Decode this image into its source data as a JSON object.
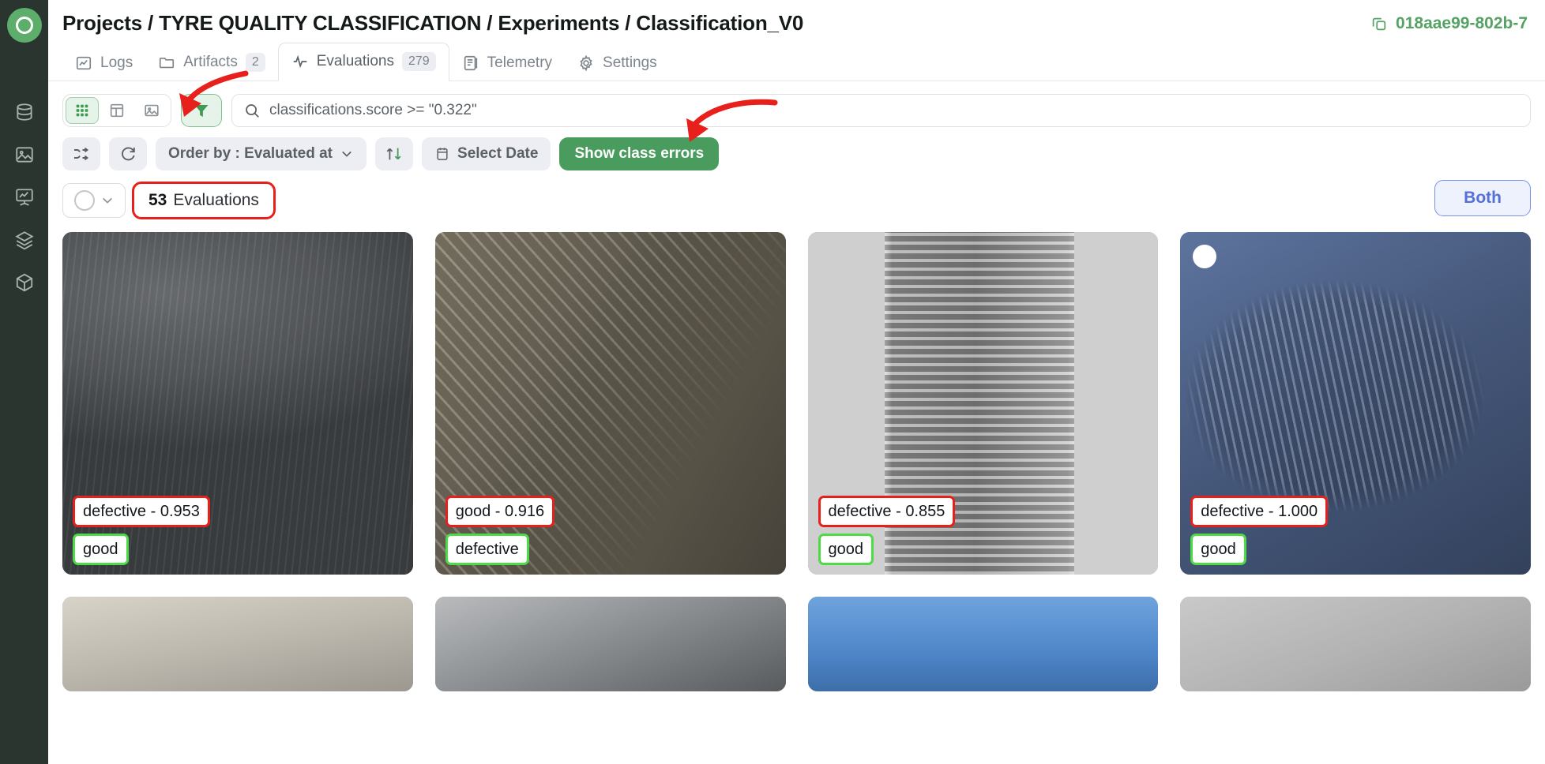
{
  "sidebar": {
    "logo_name": "app-logo",
    "items": [
      {
        "icon": "database-icon",
        "name": "datasets"
      },
      {
        "icon": "image-icon",
        "name": "images"
      },
      {
        "icon": "chart-board-icon",
        "name": "experiments"
      },
      {
        "icon": "layers-icon",
        "name": "layers"
      },
      {
        "icon": "cube-icon",
        "name": "models"
      }
    ]
  },
  "header": {
    "breadcrumb": "Projects / TYRE QUALITY CLASSIFICATION / Experiments / Classification_V0",
    "run_id": "018aae99-802b-7",
    "copy_icon": "copy-icon",
    "run_id_color": "#56a264"
  },
  "tabs": [
    {
      "label": "Logs",
      "icon": "line-chart-icon",
      "badge": "",
      "active": false
    },
    {
      "label": "Artifacts",
      "icon": "folder-icon",
      "badge": "2",
      "active": false
    },
    {
      "label": "Evaluations",
      "icon": "activity-icon",
      "badge": "279",
      "active": true
    },
    {
      "label": "Telemetry",
      "icon": "telemetry-icon",
      "badge": "",
      "active": false
    },
    {
      "label": "Settings",
      "icon": "gear-icon",
      "badge": "",
      "active": false
    }
  ],
  "toolbar": {
    "view_modes": [
      {
        "name": "grid-view",
        "icon": "grid-icon",
        "active": true
      },
      {
        "name": "table-view",
        "icon": "table-icon",
        "active": false
      },
      {
        "name": "image-view",
        "icon": "image-icon",
        "active": false
      }
    ],
    "filter_button": {
      "name": "filter-button",
      "icon": "funnel-icon",
      "active": true
    },
    "search": {
      "icon": "search-icon",
      "value": "classifications.score >= \"0.322\"",
      "placeholder": "Search"
    },
    "shuffle_button": {
      "icon": "shuffle-icon",
      "label": ""
    },
    "refresh_button": {
      "icon": "refresh-icon",
      "label": ""
    },
    "order_by": {
      "label": "Order by : Evaluated at",
      "chevron": "chevron-down-icon"
    },
    "sort_direction": {
      "label": "↑↓"
    },
    "select_date": {
      "label": "Select Date",
      "icon": "calendar-icon"
    },
    "show_class_errors": {
      "label": "Show class errors",
      "color": "#4a9b5e"
    }
  },
  "results": {
    "count": "53",
    "count_label": "Evaluations",
    "highlight_color": "#e8201c",
    "both_toggle": {
      "label": "Both",
      "color": "#5570d6"
    },
    "selector": {
      "icon": "circle-icon",
      "chevron": "chevron-down-icon"
    }
  },
  "cards": [
    {
      "photo": "ph-1",
      "prediction": "defective - 0.953",
      "ground_truth": "good",
      "selected": false
    },
    {
      "photo": "ph-2",
      "prediction": "good - 0.916",
      "ground_truth": "defective",
      "selected": false
    },
    {
      "photo": "ph-3",
      "prediction": "defective - 0.855",
      "ground_truth": "good",
      "selected": false
    },
    {
      "photo": "ph-4",
      "prediction": "defective - 1.000",
      "ground_truth": "good",
      "selected": true
    }
  ],
  "cards_row2": [
    {
      "photo": "ph-5"
    },
    {
      "photo": "ph-6"
    },
    {
      "photo": "ph-7"
    },
    {
      "photo": "ph-8"
    }
  ],
  "annotations": {
    "arrow_color": "#e8201c",
    "arrow_to_filter": "arrow-pointing-to-filter-button",
    "arrow_to_show_class_errors": "arrow-pointing-to-show-class-errors"
  }
}
